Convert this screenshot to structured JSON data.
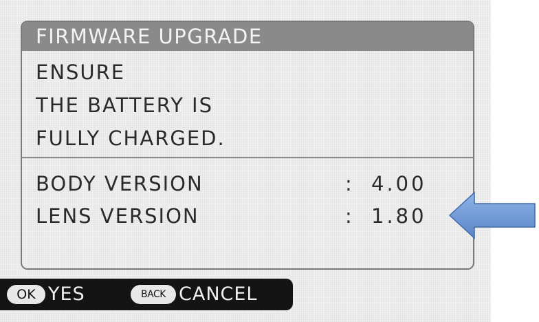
{
  "dialog": {
    "title": "FIRMWARE UPGRADE",
    "message_lines": [
      "ENSURE",
      "THE BATTERY IS",
      "FULLY CHARGED."
    ],
    "versions": [
      {
        "label": "BODY VERSION",
        "separator": ":",
        "value": "4.00"
      },
      {
        "label": "LENS VERSION",
        "separator": ":",
        "value": "1.80"
      }
    ]
  },
  "bottom_bar": {
    "ok_key": "OK",
    "ok_label": "YES",
    "back_key": "BACK",
    "back_label": "CANCEL"
  },
  "annotation": {
    "arrow_icon": "left-arrow-icon",
    "arrow_color": "#6f9bd8"
  }
}
